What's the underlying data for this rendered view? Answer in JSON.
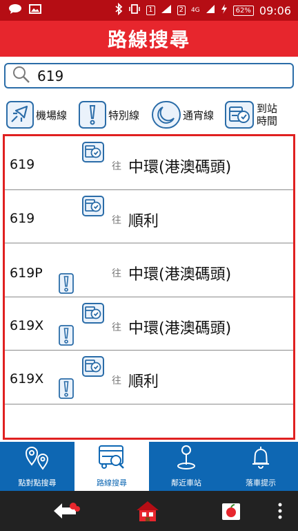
{
  "status_bar": {
    "sim1": "1",
    "sim2": "2",
    "network": "4G",
    "battery": "62%",
    "time": "09:06"
  },
  "header": {
    "title": "路線搜尋"
  },
  "search": {
    "value": "619"
  },
  "filters": [
    {
      "label": "機場線",
      "icon": "airplane-icon"
    },
    {
      "label": "特別線",
      "icon": "exclamation-icon"
    },
    {
      "label": "通宵線",
      "icon": "moon-icon"
    },
    {
      "label_line1": "到站",
      "label_line2": "時間",
      "icon": "bus-clock-icon"
    }
  ],
  "routes": [
    {
      "route": "619",
      "direction_word": "往",
      "destination": "中環(港澳碼頭)",
      "schedule": true,
      "special": false
    },
    {
      "route": "619",
      "direction_word": "往",
      "destination": "順利",
      "schedule": true,
      "special": false
    },
    {
      "route": "619P",
      "direction_word": "往",
      "destination": "中環(港澳碼頭)",
      "schedule": false,
      "special": true
    },
    {
      "route": "619X",
      "direction_word": "往",
      "destination": "中環(港澳碼頭)",
      "schedule": true,
      "special": true
    },
    {
      "route": "619X",
      "direction_word": "往",
      "destination": "順利",
      "schedule": true,
      "special": true
    }
  ],
  "tabs": [
    {
      "label": "點對點搜尋",
      "icon": "map-pins-icon",
      "active": false
    },
    {
      "label": "路線搜尋",
      "icon": "bus-search-icon",
      "active": true
    },
    {
      "label": "鄰近車站",
      "icon": "location-pin-icon",
      "active": false
    },
    {
      "label": "落車提示",
      "icon": "bell-icon",
      "active": false
    }
  ],
  "colors": {
    "brand_red": "#e7262d",
    "tab_blue": "#0e67b3",
    "icon_blue": "#2a6ca8"
  }
}
